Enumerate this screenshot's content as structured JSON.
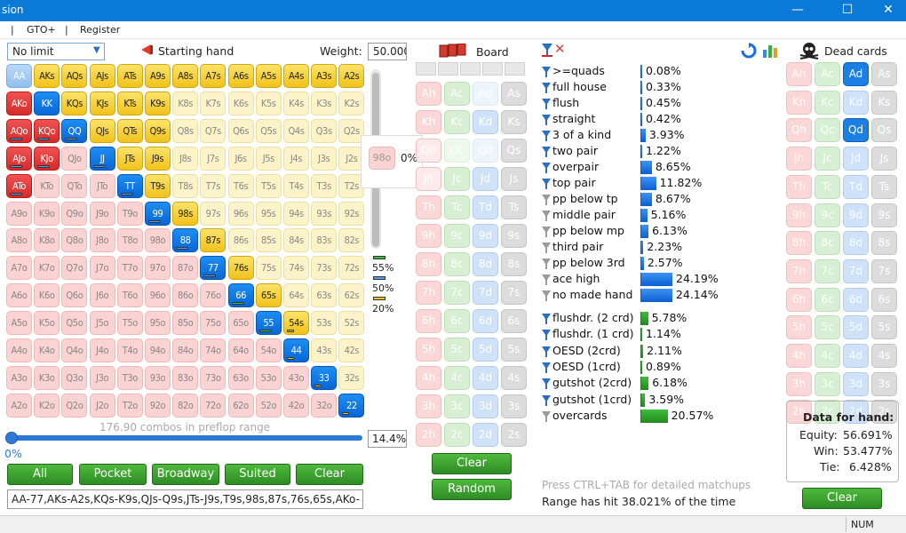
{
  "window": {
    "title": "sion",
    "minimize": "—",
    "maximize": "☐",
    "close": "✕"
  },
  "menu": [
    "|",
    "GTO+",
    "|",
    "Register"
  ],
  "left": {
    "mode_select": "No limit",
    "starting_hand_label": "Starting hand",
    "weight_label": "Weight:",
    "weight_value": "50.000",
    "combos_text": "176.90 combos in preflop range",
    "pct_value": "14.4%",
    "slider_pct": "0%",
    "range_text": "AA-77,AKs-A2s,KQs-K9s,QJs-Q9s,JTs-J9s,T9s,98s,87s,76s,65s,AKo-",
    "buttons": [
      "All",
      "Pocket",
      "Broadway",
      "Suited",
      "Clear"
    ],
    "legend": [
      "55%",
      "50%",
      "20%"
    ],
    "tooltip_hand": "98o",
    "tooltip_pct": "0%"
  },
  "ranks": [
    "A",
    "K",
    "Q",
    "J",
    "T",
    "9",
    "8",
    "7",
    "6",
    "5",
    "4",
    "3",
    "2"
  ],
  "board": {
    "label": "Board",
    "buttons": [
      "Clear",
      "Random"
    ]
  },
  "stats": {
    "rows": [
      {
        "name": ">=quads",
        "value": "0.08%",
        "pct": 0.08,
        "color": "blue",
        "filter": "blue"
      },
      {
        "name": "full house",
        "value": "0.33%",
        "pct": 0.33,
        "color": "blue",
        "filter": "blue"
      },
      {
        "name": "flush",
        "value": "0.45%",
        "pct": 0.45,
        "color": "blue",
        "filter": "blue"
      },
      {
        "name": "straight",
        "value": "0.42%",
        "pct": 0.42,
        "color": "blue",
        "filter": "blue"
      },
      {
        "name": "3 of a kind",
        "value": "3.93%",
        "pct": 3.93,
        "color": "blue",
        "filter": "blue"
      },
      {
        "name": "two pair",
        "value": "1.22%",
        "pct": 1.22,
        "color": "blue",
        "filter": "blue"
      },
      {
        "name": "overpair",
        "value": "8.65%",
        "pct": 8.65,
        "color": "blue",
        "filter": "blue"
      },
      {
        "name": "top pair",
        "value": "11.82%",
        "pct": 11.82,
        "color": "blue",
        "filter": "blue"
      },
      {
        "name": "pp below tp",
        "value": "8.67%",
        "pct": 8.67,
        "color": "blue",
        "filter": "gray"
      },
      {
        "name": "middle pair",
        "value": "5.16%",
        "pct": 5.16,
        "color": "blue",
        "filter": "gray"
      },
      {
        "name": "pp below mp",
        "value": "6.13%",
        "pct": 6.13,
        "color": "blue",
        "filter": "gray"
      },
      {
        "name": "third pair",
        "value": "2.23%",
        "pct": 2.23,
        "color": "blue",
        "filter": "gray"
      },
      {
        "name": "pp below 3rd",
        "value": "2.57%",
        "pct": 2.57,
        "color": "blue",
        "filter": "gray"
      },
      {
        "name": "ace high",
        "value": "24.19%",
        "pct": 24.19,
        "color": "blue",
        "filter": "gray"
      },
      {
        "name": "no made hand",
        "value": "24.14%",
        "pct": 24.14,
        "color": "blue",
        "filter": "gray"
      },
      {
        "name": "flushdr. (2 crd)",
        "value": "5.78%",
        "pct": 5.78,
        "color": "green",
        "filter": "blue"
      },
      {
        "name": "flushdr. (1 crd)",
        "value": "1.14%",
        "pct": 1.14,
        "color": "green",
        "filter": "blue"
      },
      {
        "name": "OESD (2crd)",
        "value": "2.11%",
        "pct": 2.11,
        "color": "green",
        "filter": "blue"
      },
      {
        "name": "OESD (1crd)",
        "value": "0.89%",
        "pct": 0.89,
        "color": "green",
        "filter": "blue"
      },
      {
        "name": "gutshot (2crd)",
        "value": "6.18%",
        "pct": 6.18,
        "color": "green",
        "filter": "blue"
      },
      {
        "name": "gutshot (1crd)",
        "value": "3.59%",
        "pct": 3.59,
        "color": "green",
        "filter": "blue"
      },
      {
        "name": "overcards",
        "value": "20.57%",
        "pct": 20.57,
        "color": "green",
        "filter": "gray"
      }
    ],
    "footer1": "Press CTRL+TAB for detailed matchups",
    "footer2": "Range has hit 38.021% of the time"
  },
  "dead": {
    "label": "Dead cards",
    "clear": "Clear",
    "selected": [
      "Ad",
      "Qd"
    ]
  },
  "handdata": {
    "title": "Data for hand:",
    "equity_label": "Equity:",
    "equity": "56.691%",
    "win_label": "Win:",
    "win": "53.477%",
    "tie_label": "Tie:",
    "tie": "6.428%"
  },
  "status": {
    "num": "NUM"
  },
  "colors": {
    "titlebar": "#0a7ad6",
    "accent_green": "#38a02e",
    "selected_blue": "#1c7fe4"
  }
}
